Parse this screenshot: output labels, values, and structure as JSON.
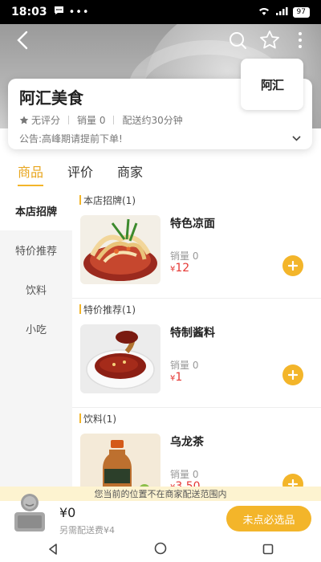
{
  "status_bar": {
    "time": "18:03",
    "battery": "97"
  },
  "shop": {
    "name": "阿汇美食",
    "rating": "无评分",
    "sales": "销量 0",
    "delivery": "配送约30分钟",
    "notice": "公告:高峰期请提前下单!",
    "logo_text": "阿汇"
  },
  "tabs": [
    "商品",
    "评价",
    "商家"
  ],
  "sidebar": [
    "本店招牌",
    "特价推荐",
    "饮料",
    "小吃"
  ],
  "sections": [
    {
      "title": "本店招牌(1)",
      "product": {
        "name": "特色凉面",
        "sales": "销量 0",
        "currency": "¥",
        "price": "12"
      }
    },
    {
      "title": "特价推荐(1)",
      "product": {
        "name": "特制酱料",
        "sales": "销量 0",
        "currency": "¥",
        "price": "1"
      }
    },
    {
      "title": "饮料(1)",
      "product": {
        "name": "乌龙茶",
        "sales": "销量 0",
        "currency": "¥",
        "price": "3.50"
      }
    }
  ],
  "range_notice": "您当前的位置不在商家配送范围内",
  "cart": {
    "total": "¥0",
    "fee": "另需配送费¥4",
    "checkout": "未点必选品"
  },
  "colors": {
    "accent": "#f3b52a",
    "price": "#e53935"
  }
}
